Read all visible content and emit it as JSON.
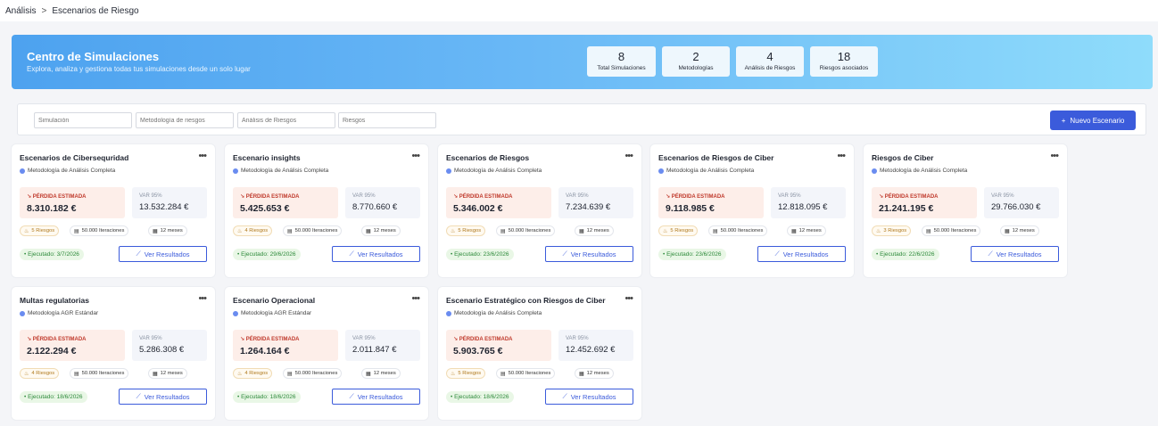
{
  "breadcrumb": {
    "parent": "Análisis",
    "separator": ">",
    "current": "Escenarios de Riesgo"
  },
  "hero": {
    "title": "Centro de Simulaciones",
    "subtitle": "Explora, analiza y gestiona todas tus simulaciones desde un solo lugar",
    "stats": [
      {
        "value": "8",
        "label": "Total Simulaciones"
      },
      {
        "value": "2",
        "label": "Metodologías"
      },
      {
        "value": "4",
        "label": "Análisis de Riesgos"
      },
      {
        "value": "18",
        "label": "Riesgos asociados"
      }
    ]
  },
  "filters": {
    "simulation_placeholder": "Simulación",
    "methodology_placeholder": "Metodología de riesgos",
    "analysis_placeholder": "Análisis de Riesgos",
    "risks_placeholder": "Riesgos",
    "new_button_label": "Nuevo Escenario",
    "new_button_icon": "+"
  },
  "card_labels": {
    "loss_label": "PÉRDIDA ESTIMADA",
    "var_label": "VAR 95%",
    "view_results": "Ver Resultados"
  },
  "cards": [
    {
      "title": "Escenarios de Cibersequridad",
      "methodology": "Metodología de Análisis Completa",
      "loss": "8.310.182 €",
      "var": "13.532.284 €",
      "risks": "5 Riesgos",
      "iterations": "50.000 Iteraciones",
      "months": "12 meses",
      "executed": "Ejecutado: 3/7/2026"
    },
    {
      "title": "Escenario insights",
      "methodology": "Metodología de Análisis Completa",
      "loss": "5.425.653 €",
      "var": "8.770.660 €",
      "risks": "4 Riesgos",
      "iterations": "50.000 Iteraciones",
      "months": "12 meses",
      "executed": "Ejecutado: 29/6/2026"
    },
    {
      "title": "Escenarios de Riesgos",
      "methodology": "Metodología de Análisis Completa",
      "loss": "5.346.002 €",
      "var": "7.234.639 €",
      "risks": "5 Riesgos",
      "iterations": "50.000 Iteraciones",
      "months": "12 meses",
      "executed": "Ejecutado: 23/6/2026"
    },
    {
      "title": "Escenarios de Riesgos de Ciber",
      "methodology": "Metodología de Análisis Completa",
      "loss": "9.118.985 €",
      "var": "12.818.095 €",
      "risks": "5 Riesgos",
      "iterations": "50.000 Iteraciones",
      "months": "12 meses",
      "executed": "Ejecutado: 23/6/2026"
    },
    {
      "title": "Riesgos de Ciber",
      "methodology": "Metodología de Análisis Completa",
      "loss": "21.241.195 €",
      "var": "29.766.030 €",
      "risks": "3 Riesgos",
      "iterations": "50.000 Iteraciones",
      "months": "12 meses",
      "executed": "Ejecutado: 22/6/2026"
    },
    {
      "title": "Multas regulatorias",
      "methodology": "Metodología AGR Estándar",
      "loss": "2.122.294 €",
      "var": "5.286.308 €",
      "risks": "4 Riesgos",
      "iterations": "50.000 Iteraciones",
      "months": "12 meses",
      "executed": "Ejecutado: 18/6/2026"
    },
    {
      "title": "Escenario Operacional",
      "methodology": "Metodología AGR Estándar",
      "loss": "1.264.164 €",
      "var": "2.011.847 €",
      "risks": "4 Riesgos",
      "iterations": "50.000 Iteraciones",
      "months": "12 meses",
      "executed": "Ejecutado: 18/6/2026"
    },
    {
      "title": "Escenario Estratégico con Riesgos de Ciber",
      "methodology": "Metodología de Análisis Completa",
      "loss": "5.903.765 €",
      "var": "12.452.692 €",
      "risks": "5 Riesgos",
      "iterations": "50.000 Iteraciones",
      "months": "12 meses",
      "executed": "Ejecutado: 18/6/2026"
    }
  ],
  "icons": {
    "more": "more-horizontal-icon",
    "methodology": "shield-icon",
    "loss": "trending-down-icon",
    "risks": "flame-icon",
    "iterations": "database-icon",
    "months": "calendar-icon",
    "results": "chart-line-icon"
  },
  "colors": {
    "accent": "#3b5bdb",
    "loss_bg": "#fdeee9",
    "loss_text": "#c0392b",
    "executed_bg": "#e9f7e6",
    "executed_text": "#2d8a3a"
  }
}
